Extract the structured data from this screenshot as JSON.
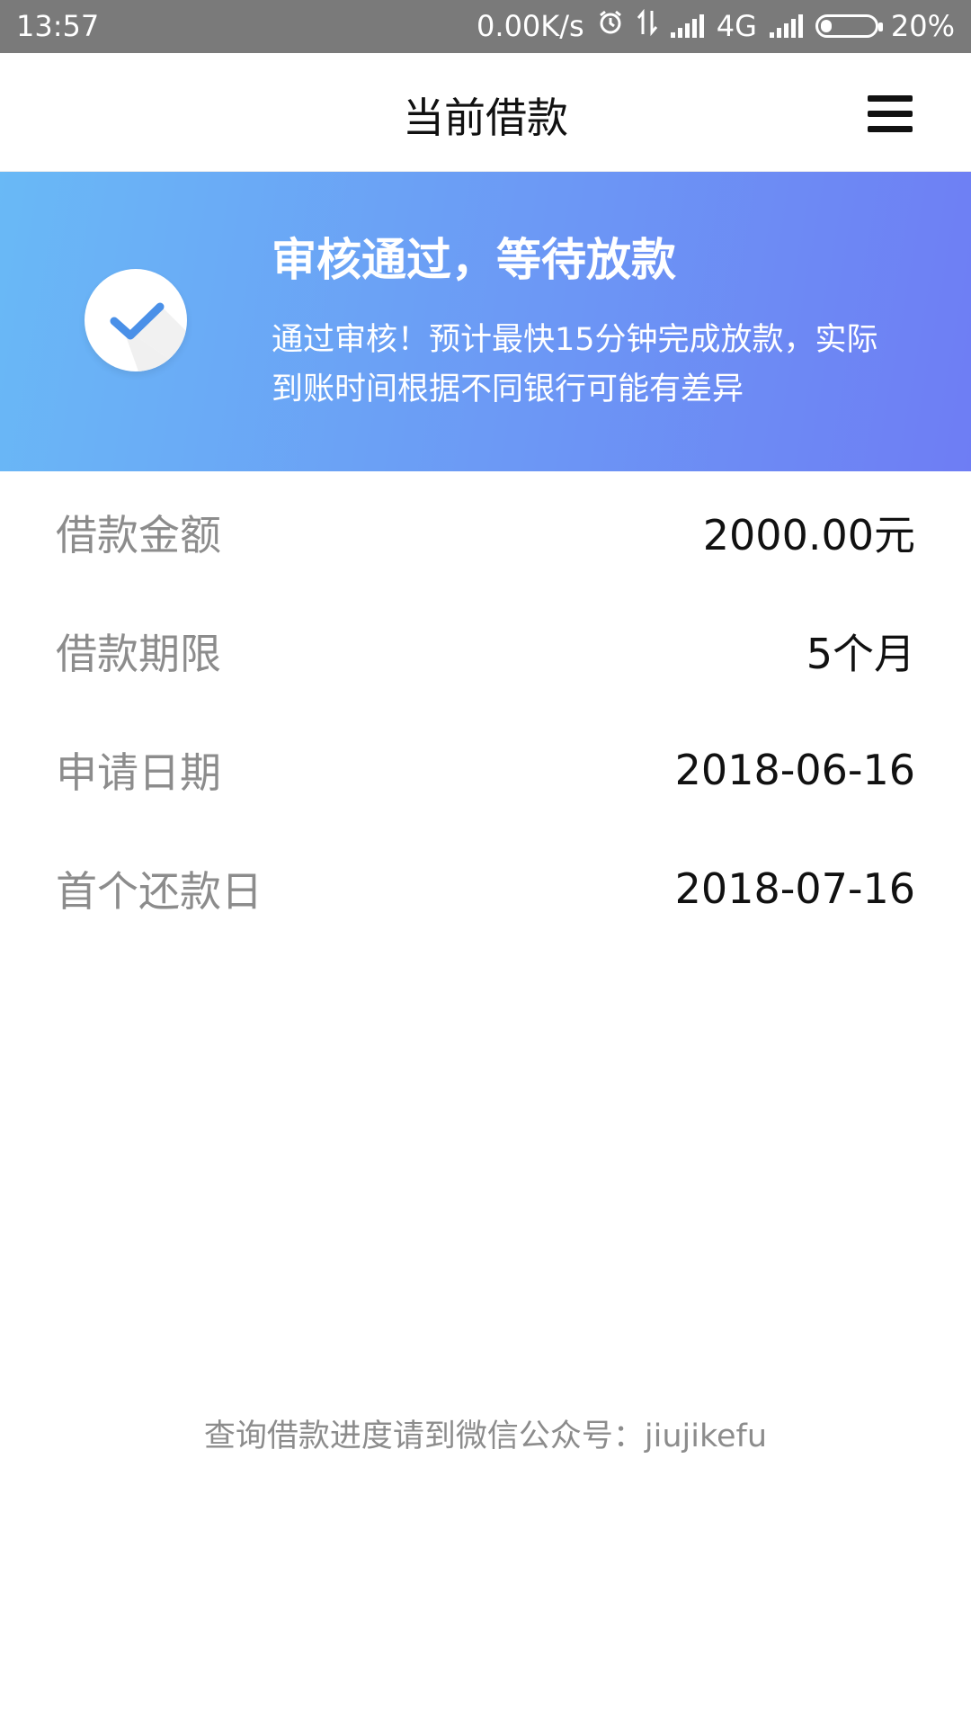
{
  "status_bar": {
    "time": "13:57",
    "net_speed": "0.00K/s",
    "network": "4G",
    "battery": "20%",
    "battery_level": 0.2
  },
  "header": {
    "title": "当前借款"
  },
  "banner": {
    "headline": "审核通过，等待放款",
    "description": "通过审核！预计最快15分钟完成放款，实际到账时间根据不同银行可能有差异",
    "gradient_start": "#69b9f6",
    "gradient_end": "#6e7df4"
  },
  "details": [
    {
      "label": "借款金额",
      "value": "2000.00元"
    },
    {
      "label": "借款期限",
      "value": "5个月"
    },
    {
      "label": "申请日期",
      "value": "2018-06-16"
    },
    {
      "label": "首个还款日",
      "value": "2018-07-16"
    }
  ],
  "footer": {
    "note": "查询借款进度请到微信公众号：jiujikefu"
  }
}
